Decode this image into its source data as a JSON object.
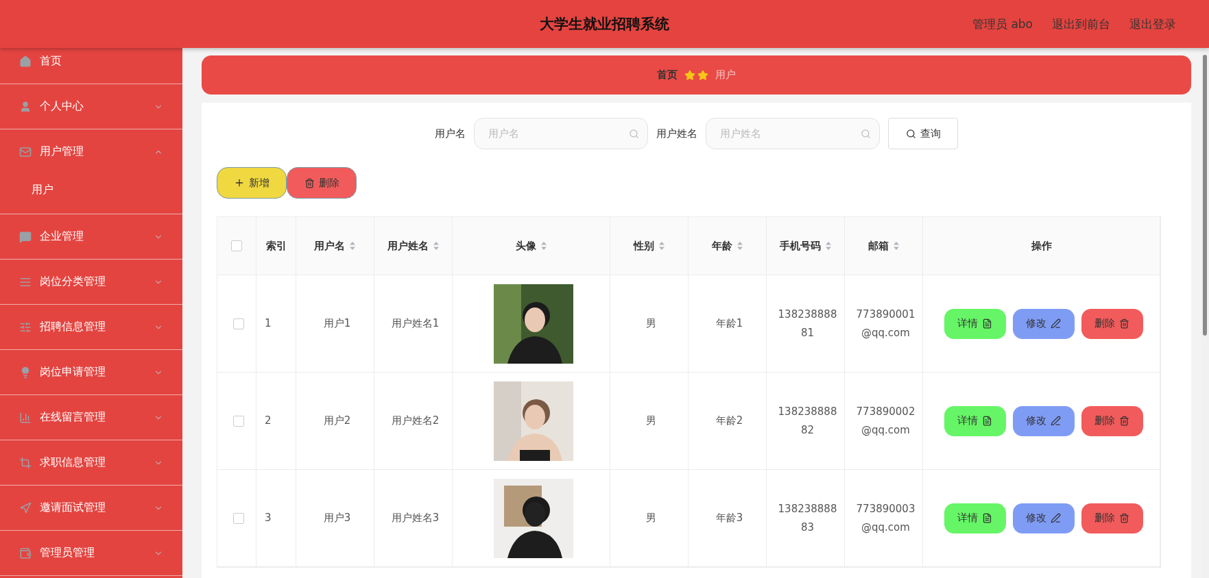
{
  "header": {
    "title": "大学生就业招聘系统",
    "links": [
      "管理员 abo",
      "退出到前台",
      "退出登录"
    ]
  },
  "sidebar": {
    "items": [
      {
        "label": "首页"
      },
      {
        "label": "个人中心",
        "expanded": false
      },
      {
        "label": "用户管理",
        "expanded": true,
        "children": [
          {
            "label": "用户"
          }
        ]
      },
      {
        "label": "企业管理",
        "expanded": false
      },
      {
        "label": "岗位分类管理",
        "expanded": false
      },
      {
        "label": "招聘信息管理",
        "expanded": false
      },
      {
        "label": "岗位申请管理",
        "expanded": false
      },
      {
        "label": "在线留言管理",
        "expanded": false
      },
      {
        "label": "求职信息管理",
        "expanded": false
      },
      {
        "label": "邀请面试管理",
        "expanded": false
      },
      {
        "label": "管理员管理",
        "expanded": false
      }
    ]
  },
  "breadcrumb": [
    "首页",
    "用户"
  ],
  "search": {
    "fields": [
      {
        "label": "用户名",
        "placeholder": "用户名"
      },
      {
        "label": "用户姓名",
        "placeholder": "用户姓名"
      }
    ],
    "button": "查询"
  },
  "actions": [
    {
      "label": "新增",
      "kind": "add"
    },
    {
      "label": "删除",
      "kind": "delete"
    }
  ],
  "table": {
    "columns": [
      {
        "kind": "checkbox",
        "checked": false
      },
      {
        "label": "索引",
        "sortable": false
      },
      {
        "label": "用户名",
        "sortable": true
      },
      {
        "label": "用户姓名",
        "sortable": true
      },
      {
        "label": "头像",
        "sortable": true
      },
      {
        "label": "性别",
        "sortable": true
      },
      {
        "label": "年龄",
        "sortable": true
      },
      {
        "label": "手机号码",
        "sortable": true
      },
      {
        "label": "邮箱",
        "sortable": true
      },
      {
        "label": "操作",
        "sortable": false
      }
    ],
    "rows": [
      {
        "cells": [
          {
            "kind": "checkbox",
            "checked": false
          },
          "1",
          "用户1",
          "用户姓名1",
          {
            "kind": "picture"
          },
          "男",
          "年龄1",
          "13823888881",
          "773890001@qq.com",
          {
            "kind": "buttons",
            "buttons": [
              {
                "label": "详情",
                "kind": "detail"
              },
              {
                "label": "修改",
                "kind": "edit"
              },
              {
                "label": "删除",
                "kind": "delete"
              }
            ]
          }
        ]
      },
      {
        "cells": [
          {
            "kind": "checkbox",
            "checked": false
          },
          "2",
          "用户2",
          "用户姓名2",
          {
            "kind": "picture"
          },
          "男",
          "年龄2",
          "13823888882",
          "773890002@qq.com",
          {
            "kind": "buttons",
            "buttons": [
              {
                "label": "详情",
                "kind": "detail"
              },
              {
                "label": "修改",
                "kind": "edit"
              },
              {
                "label": "删除",
                "kind": "delete"
              }
            ]
          }
        ]
      },
      {
        "cells": [
          {
            "kind": "checkbox",
            "checked": false
          },
          "3",
          "用户3",
          "用户姓名3",
          {
            "kind": "picture"
          },
          "男",
          "年龄3",
          "13823888883",
          "773890003@qq.com",
          {
            "kind": "buttons",
            "buttons": [
              {
                "label": "详情",
                "kind": "detail"
              },
              {
                "label": "修改",
                "kind": "edit"
              },
              {
                "label": "删除",
                "kind": "delete"
              }
            ]
          }
        ]
      }
    ]
  }
}
